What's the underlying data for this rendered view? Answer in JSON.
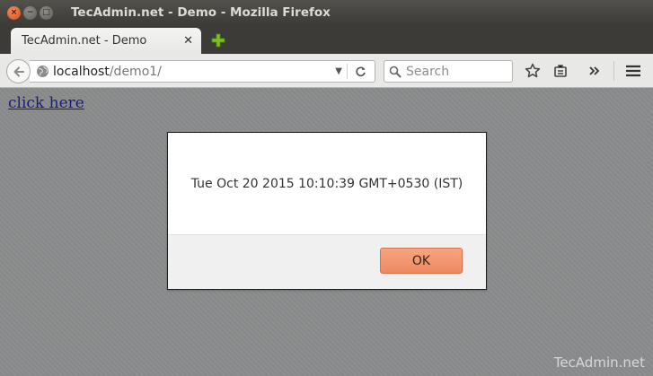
{
  "window": {
    "title": "TecAdmin.net - Demo - Mozilla Firefox",
    "close_glyph": "×",
    "minimize_glyph": "−",
    "maximize_glyph": "□"
  },
  "tabs": [
    {
      "label": "TecAdmin.net - Demo",
      "close_glyph": "✕"
    }
  ],
  "navbar": {
    "url_host": "localhost",
    "url_path": "/demo1/",
    "search_placeholder": "Search"
  },
  "page": {
    "link_text": "click here"
  },
  "dialog": {
    "message": "Tue Oct 20 2015 10:10:39 GMT+0530 (IST)",
    "ok_label": "OK"
  },
  "watermark": "TecAdmin.net",
  "icons": {
    "back": "back-arrow-icon",
    "globe": "globe-icon",
    "dropdown": "dropdown-arrow-icon",
    "reload": "reload-icon",
    "search": "search-icon",
    "bookmark": "star-icon",
    "reading_list": "reading-list-icon",
    "overflow": "chevron-double-right-icon",
    "menu": "hamburger-menu-icon",
    "new_tab": "plus-icon"
  },
  "colors": {
    "accent_ok": "#ee8a62",
    "titlebar": "#3c3b37",
    "close_button": "#df4a16",
    "new_tab_plus": "#7cc11f"
  }
}
